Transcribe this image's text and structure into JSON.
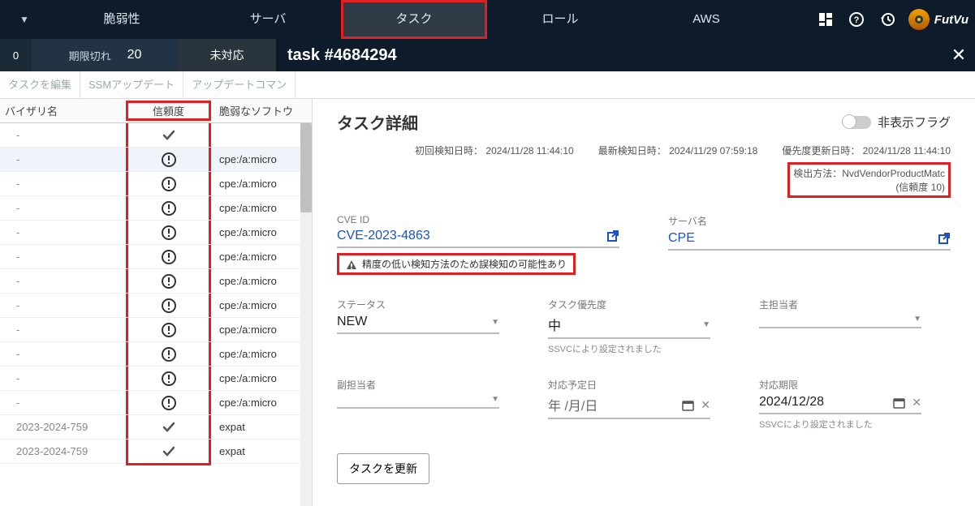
{
  "nav": {
    "items": [
      "脆弱性",
      "サーバ",
      "タスク",
      "ロール",
      "AWS"
    ],
    "brand": "FutVu"
  },
  "subbar": {
    "num0": "0",
    "expired_label": "期限切れ",
    "expired_num": "20",
    "unhandled": "未対応",
    "title": "task #4684294"
  },
  "actions": {
    "edit": "タスクを編集",
    "ssm": "SSMアップデート",
    "updatecmd": "アップデートコマン"
  },
  "table": {
    "head": {
      "advisory": "バイザリ名",
      "conf": "信頼度",
      "soft": "脆弱なソフトウ"
    },
    "rows": [
      {
        "adv": "-",
        "conf": "check",
        "soft": ""
      },
      {
        "adv": "-",
        "conf": "warn",
        "soft": "cpe:/a:micro"
      },
      {
        "adv": "-",
        "conf": "warn",
        "soft": "cpe:/a:micro"
      },
      {
        "adv": "-",
        "conf": "warn",
        "soft": "cpe:/a:micro"
      },
      {
        "adv": "-",
        "conf": "warn",
        "soft": "cpe:/a:micro"
      },
      {
        "adv": "-",
        "conf": "warn",
        "soft": "cpe:/a:micro"
      },
      {
        "adv": "-",
        "conf": "warn",
        "soft": "cpe:/a:micro"
      },
      {
        "adv": "-",
        "conf": "warn",
        "soft": "cpe:/a:micro"
      },
      {
        "adv": "-",
        "conf": "warn",
        "soft": "cpe:/a:micro"
      },
      {
        "adv": "-",
        "conf": "warn",
        "soft": "cpe:/a:micro"
      },
      {
        "adv": "-",
        "conf": "warn",
        "soft": "cpe:/a:micro"
      },
      {
        "adv": "-",
        "conf": "warn",
        "soft": "cpe:/a:micro"
      },
      {
        "adv": "2023-2024-759",
        "conf": "check",
        "soft": "expat"
      },
      {
        "adv": "2023-2024-759",
        "conf": "check",
        "soft": "expat"
      }
    ]
  },
  "detail": {
    "title": "タスク詳細",
    "hide_flag": "非表示フラグ",
    "ts": {
      "first_label": "初回検知日時：",
      "first_val": "2024/11/28 11:44:10",
      "latest_label": "最新検知日時：",
      "latest_val": "2024/11/29 07:59:18",
      "prio_label": "優先度更新日時：",
      "prio_val": "2024/11/28 11:44:10"
    },
    "detect": {
      "label": "検出方法：",
      "method": "NvdVendorProductMatc",
      "conf": "(信頼度 10)"
    },
    "cve": {
      "label": "CVE ID",
      "value": "CVE-2023-4863"
    },
    "server": {
      "label": "サーバ名",
      "value": "CPE"
    },
    "warn": "精度の低い検知方法のため誤検知の可能性あり",
    "status": {
      "label": "ステータス",
      "value": "NEW"
    },
    "priority": {
      "label": "タスク優先度",
      "value": "中",
      "note": "SSVCにより設定されました"
    },
    "owner": {
      "label": "主担当者",
      "value": ""
    },
    "subowner": {
      "label": "副担当者",
      "value": ""
    },
    "planned": {
      "label": "対応予定日",
      "value": "年 /月/日"
    },
    "deadline": {
      "label": "対応期限",
      "value": "2024/12/28",
      "note": "SSVCにより設定されました"
    },
    "update_btn": "タスクを更新"
  }
}
